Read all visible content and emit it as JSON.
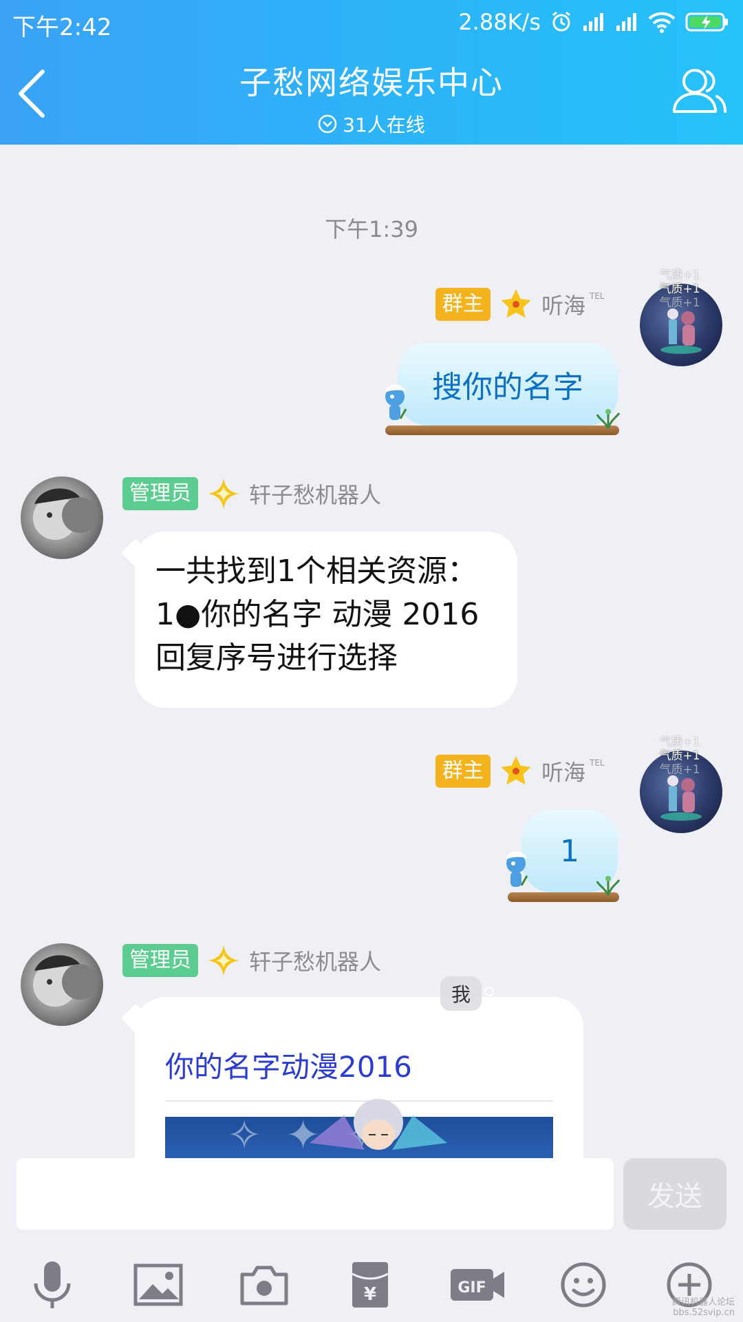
{
  "status_bar": {
    "time": "下午2:42",
    "speed": "2.88K/s"
  },
  "header": {
    "title": "子愁网络娱乐中心",
    "online_count": "31人在线"
  },
  "chat": {
    "timestamp": "下午1:39",
    "messages": [
      {
        "sender": "听海",
        "role_badge": "群主",
        "tel_tag": "TEL",
        "pendant_text": [
          "气质+1",
          "气质+1",
          "气质+1"
        ],
        "text": "搜你的名字"
      },
      {
        "sender": "轩子愁机器人",
        "role_badge": "管理员",
        "lines": [
          "一共找到1个相关资源：",
          "1●你的名字 动漫 2016",
          "回复序号进行选择"
        ]
      },
      {
        "sender": "听海",
        "role_badge": "群主",
        "tel_tag": "TEL",
        "pendant_text": [
          "气质+1",
          "气质+1",
          "气质+1"
        ],
        "text": "1"
      },
      {
        "sender": "轩子愁机器人",
        "role_badge": "管理员",
        "card_title": "你的名字动漫2016"
      }
    ]
  },
  "floating": {
    "me_label": "我"
  },
  "input": {
    "value": "",
    "send_label": "发送"
  },
  "toolbar": {
    "items": [
      "mic-icon",
      "image-icon",
      "camera-icon",
      "red-packet-icon",
      "gif-icon",
      "emoji-icon",
      "plus-icon"
    ],
    "gif_label": "GIF"
  },
  "watermark": {
    "line1": "腾讯机器人论坛",
    "line2": "bbs.52svip.cn"
  }
}
